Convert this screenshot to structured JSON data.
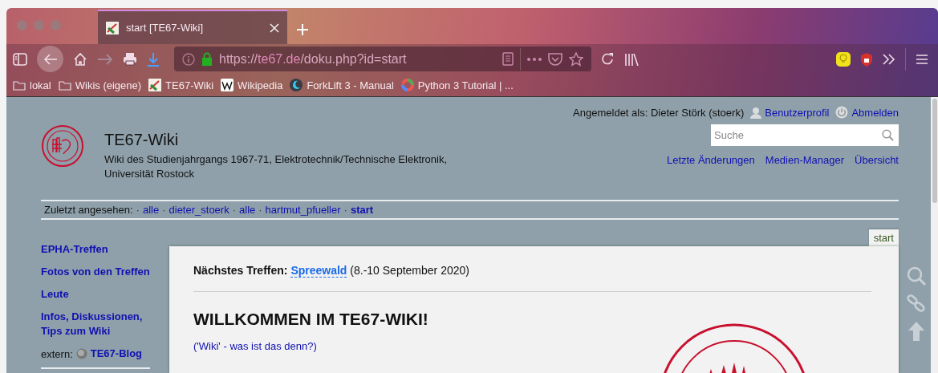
{
  "browser": {
    "tabs": [
      {
        "title": "start [TE67-Wiki]",
        "selected": true
      }
    ],
    "url": {
      "scheme": "https://",
      "host": "te67.de",
      "path": "/doku.php?id=start"
    },
    "bookmarks": [
      {
        "label": "lokal",
        "kind": "folder"
      },
      {
        "label": "Wikis (eigene)",
        "kind": "folder"
      },
      {
        "label": "TE67-Wiki",
        "kind": "te67"
      },
      {
        "label": "Wikipedia",
        "kind": "wikipedia"
      },
      {
        "label": "ForkLift 3 - Manual",
        "kind": "forklift"
      },
      {
        "label": "Python 3 Tutorial | ...",
        "kind": "python"
      }
    ]
  },
  "header": {
    "user_line": "Angemeldet als: Dieter Störk (stoerk)",
    "user_links": [
      {
        "label": "Benutzerprofil",
        "kind": "profile"
      },
      {
        "label": "Abmelden",
        "kind": "logout"
      }
    ],
    "search": {
      "placeholder": "Suche"
    },
    "site_links": [
      "Letzte Änderungen",
      "Medien-Manager",
      "Übersicht"
    ],
    "title": "TE67-Wiki",
    "subtitle": [
      "Wiki des Studienjahrgangs 1967-71, Elektrotechnik/Technische Elektronik,",
      "Universität Rostock"
    ]
  },
  "breadcrumbs": {
    "label": "Zuletzt angesehen:",
    "separator": "·",
    "items": [
      {
        "label": "alle",
        "selected": false
      },
      {
        "label": "dieter_stoerk",
        "selected": false
      },
      {
        "label": "alle",
        "selected": false
      },
      {
        "label": "hartmut_pfueller",
        "selected": false
      },
      {
        "label": "start",
        "selected": true
      }
    ]
  },
  "sidebar": {
    "items": [
      "EPHA-Treffen",
      "Fotos von den Treffen",
      "Leute",
      "Infos, Diskussionen, Tips zum Wiki"
    ],
    "extern": {
      "label": "extern:",
      "link": "TE67-Blog"
    }
  },
  "content": {
    "page_tab": "start",
    "next_meeting": {
      "label": "Nächstes Treffen:",
      "link": "Spreewald",
      "rest": "(8.-10 September 2020)"
    },
    "heading": "WILLKOMMEN IM TE67-WIKI!",
    "intro_link": "('Wiki' - was ist das denn?)"
  }
}
